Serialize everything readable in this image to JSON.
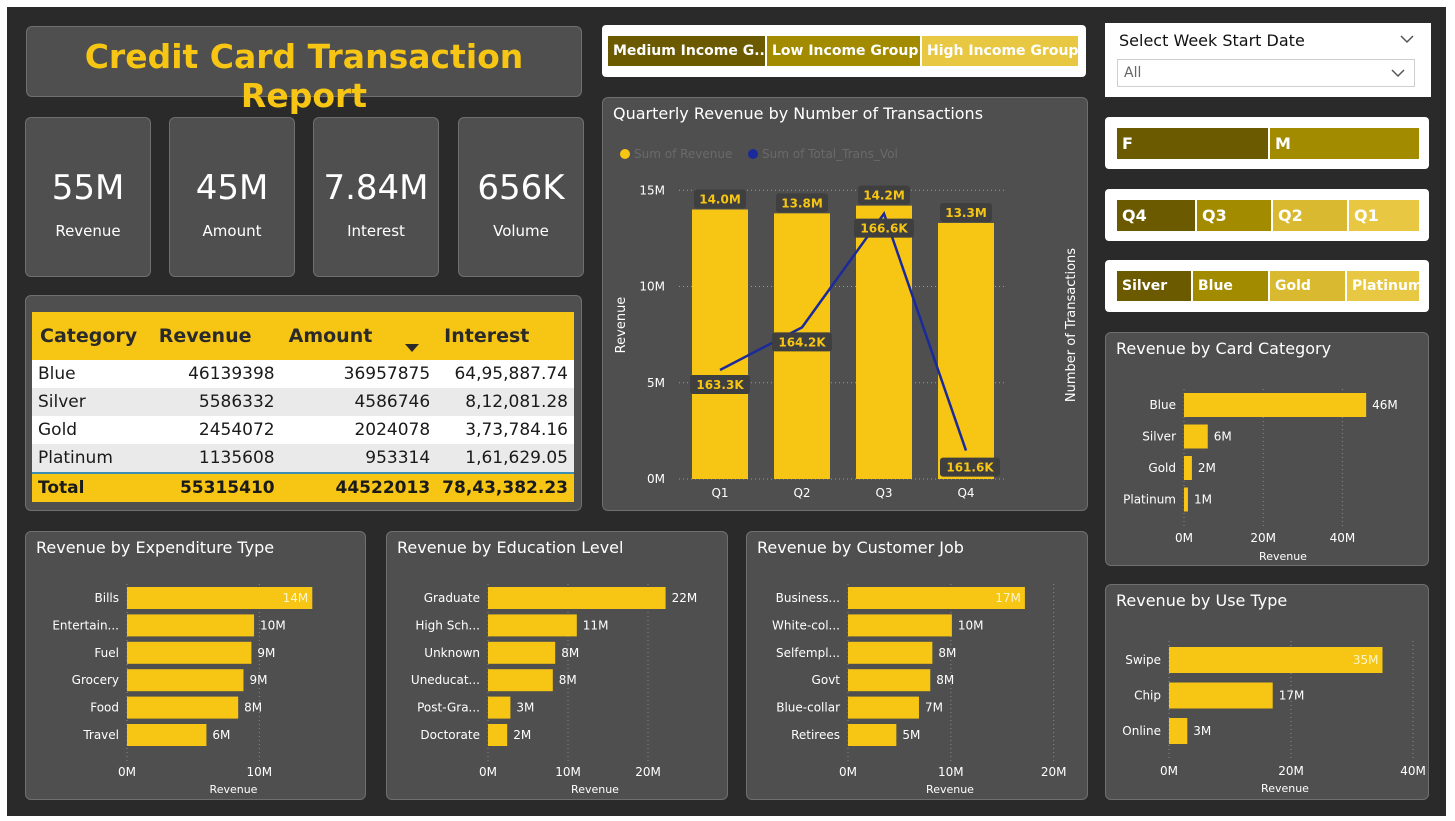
{
  "report": {
    "title": "Credit Card Transaction Report"
  },
  "income_slicer": {
    "items": [
      "Medium Income G...",
      "Low Income Group",
      "High Income Group"
    ],
    "colors": [
      "#6b5a00",
      "#a38b00",
      "#e8c843"
    ]
  },
  "week_slicer": {
    "label": "Select Week Start Date",
    "value": "All"
  },
  "gender_slicer": {
    "items": [
      "F",
      "M"
    ],
    "colors": [
      "#6b5a00",
      "#a38b00"
    ]
  },
  "quarter_slicer": {
    "items": [
      "Q4",
      "Q3",
      "Q2",
      "Q1"
    ],
    "colors": [
      "#6b5a00",
      "#a38b00",
      "#d9b930",
      "#e8c843"
    ]
  },
  "card_slicer": {
    "items": [
      "Silver",
      "Blue",
      "Gold",
      "Platinum"
    ],
    "colors": [
      "#6b5a00",
      "#a38b00",
      "#d9b930",
      "#e8c843"
    ]
  },
  "kpis": [
    {
      "value": "55M",
      "label": "Revenue"
    },
    {
      "value": "45M",
      "label": "Amount"
    },
    {
      "value": "7.84M",
      "label": "Interest"
    },
    {
      "value": "656K",
      "label": "Volume"
    }
  ],
  "table": {
    "headers": [
      "Category",
      "Revenue",
      "Amount",
      "Interest"
    ],
    "rows": [
      [
        "Blue",
        "46139398",
        "36957875",
        "64,95,887.74"
      ],
      [
        "Silver",
        "5586332",
        "4586746",
        "8,12,081.28"
      ],
      [
        "Gold",
        "2454072",
        "2024078",
        "3,73,784.16"
      ],
      [
        "Platinum",
        "1135608",
        "953314",
        "1,61,629.05"
      ]
    ],
    "total": [
      "Total",
      "55315410",
      "44522013",
      "78,43,382.23"
    ]
  },
  "colors": {
    "accent": "#f7c514",
    "line": "#1b2a9a",
    "panel": "#4f4f4f",
    "background": "#2a2a2a"
  },
  "chart_data": [
    {
      "id": "quarterly",
      "type": "bar",
      "title": "Quarterly Revenue by Number of Transactions",
      "categories": [
        "Q1",
        "Q2",
        "Q3",
        "Q4"
      ],
      "series": [
        {
          "name": "Sum of Revenue",
          "values": [
            14.0,
            13.8,
            14.2,
            13.3
          ],
          "labels": [
            "14.0M",
            "13.8M",
            "14.2M",
            "13.3M"
          ]
        },
        {
          "name": "Sum of Total_Trans_Vol",
          "values": [
            163.3,
            164.2,
            166.6,
            161.6
          ],
          "labels": [
            "163.3K",
            "164.2K",
            "166.6K",
            "161.6K"
          ]
        }
      ],
      "xlabel": "",
      "ylabel": "Revenue",
      "y2label": "Number of Transactions",
      "ylim": [
        0,
        16
      ],
      "yticks": [
        0,
        5,
        10,
        15
      ],
      "ytick_labels": [
        "0M",
        "5M",
        "10M",
        "15M"
      ],
      "y2lim": [
        161,
        167.5
      ],
      "legend": "top-left",
      "grid": true
    },
    {
      "id": "card",
      "type": "bar",
      "title": "Revenue by Card Category",
      "categories": [
        "Blue",
        "Silver",
        "Gold",
        "Platinum"
      ],
      "values": [
        46,
        6,
        2,
        1
      ],
      "labels": [
        "46M",
        "6M",
        "2M",
        "1M"
      ],
      "xlabel": "Revenue",
      "xlim": [
        0,
        50
      ],
      "xticks": [
        0,
        20,
        40
      ],
      "xtick_labels": [
        "0M",
        "20M",
        "40M"
      ],
      "grid": true
    },
    {
      "id": "expenditure",
      "type": "bar",
      "title": "Revenue by Expenditure Type",
      "categories": [
        "Bills",
        "Entertain...",
        "Fuel",
        "Grocery",
        "Food",
        "Travel"
      ],
      "values": [
        14,
        9.6,
        9.4,
        8.8,
        8.4,
        6.0
      ],
      "labels": [
        "14M",
        "10M",
        "9M",
        "9M",
        "8M",
        "6M"
      ],
      "xlabel": "Revenue",
      "xlim": [
        0,
        17
      ],
      "xticks": [
        0,
        10
      ],
      "xtick_labels": [
        "0M",
        "10M"
      ],
      "grid": true
    },
    {
      "id": "education",
      "type": "bar",
      "title": "Revenue by Education Level",
      "categories": [
        "Graduate",
        "High Sch...",
        "Unknown",
        "Uneducat...",
        "Post-Gra...",
        "Doctorate"
      ],
      "values": [
        22.2,
        11.1,
        8.4,
        8.1,
        2.8,
        2.4
      ],
      "labels": [
        "22M",
        "11M",
        "8M",
        "8M",
        "3M",
        "2M"
      ],
      "xlabel": "Revenue",
      "xlim": [
        0,
        28
      ],
      "xticks": [
        0,
        10,
        20
      ],
      "xtick_labels": [
        "0M",
        "10M",
        "20M"
      ],
      "grid": true
    },
    {
      "id": "job",
      "type": "bar",
      "title": "Revenue by Customer Job",
      "categories": [
        "Business...",
        "White-col...",
        "Selfempl...",
        "Govt",
        "Blue-collar",
        "Retirees"
      ],
      "values": [
        17.2,
        10.1,
        8.2,
        8.0,
        6.9,
        4.7
      ],
      "labels": [
        "17M",
        "10M",
        "8M",
        "8M",
        "7M",
        "5M"
      ],
      "xlabel": "Revenue",
      "xlim": [
        0,
        21
      ],
      "xticks": [
        0,
        10,
        20
      ],
      "xtick_labels": [
        "0M",
        "10M",
        "20M"
      ],
      "grid": true
    },
    {
      "id": "usetype",
      "type": "bar",
      "title": "Revenue by Use Type",
      "categories": [
        "Swipe",
        "Chip",
        "Online"
      ],
      "values": [
        35,
        17,
        3
      ],
      "labels": [
        "35M",
        "17M",
        "3M"
      ],
      "xlabel": "Revenue",
      "xlim": [
        0,
        40
      ],
      "xticks": [
        0,
        20,
        40
      ],
      "xtick_labels": [
        "0M",
        "20M",
        "40M"
      ],
      "grid": true
    }
  ]
}
